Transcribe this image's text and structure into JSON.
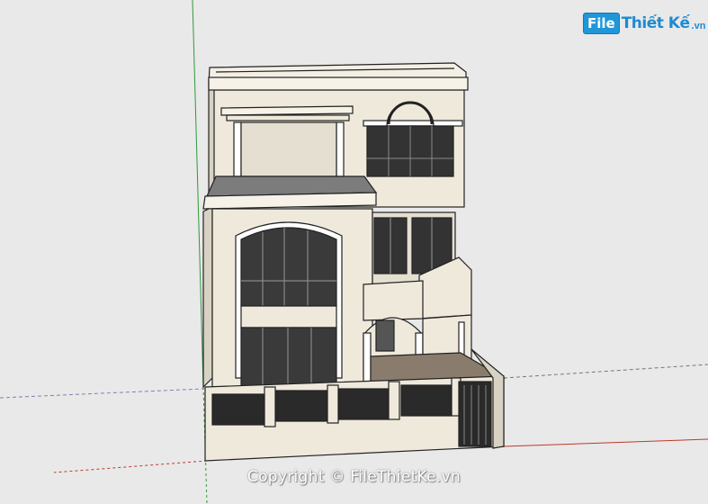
{
  "watermark": {
    "logo_mark": "File",
    "logo_text": "Thiết Kế",
    "logo_tld": ".vn",
    "copyright": "Copyright © FileThietKe.vn"
  },
  "colors": {
    "background": "#e9e9e9",
    "wall": "#efe9dc",
    "wall_shade": "#d8d2c4",
    "glass": "#3a3a3a",
    "trim": "#ffffff",
    "roof": "#7c7c7c",
    "logo_blue": "#1f97d8"
  }
}
